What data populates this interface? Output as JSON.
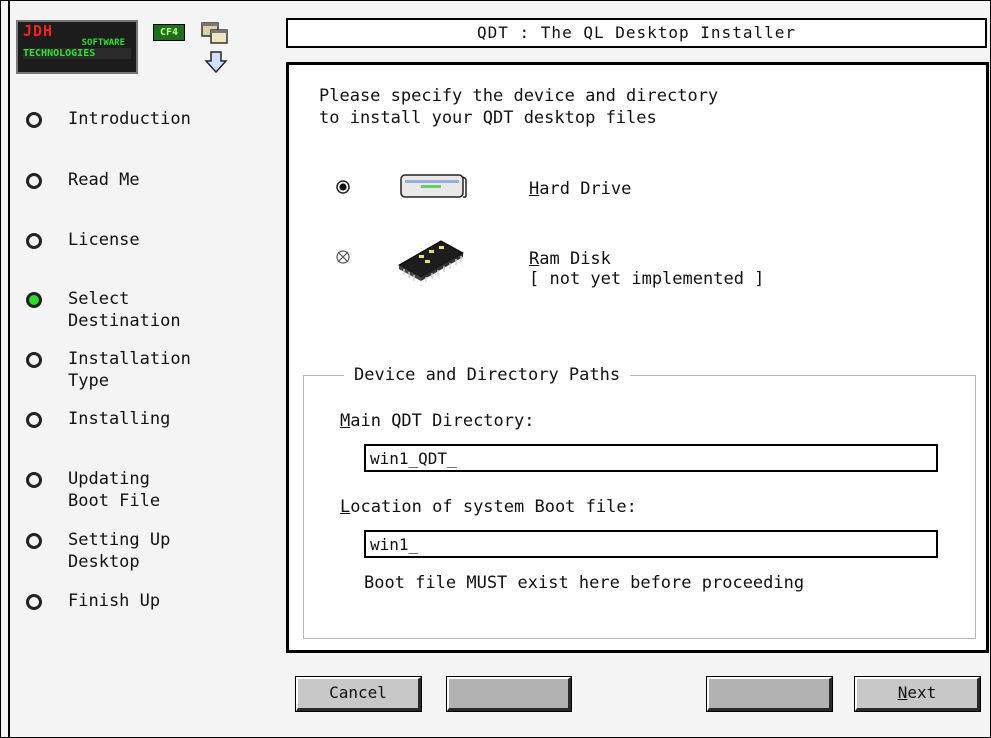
{
  "logo": {
    "line1": "JDH",
    "line2": "SOFTWARE",
    "line3": "TECHNOLOGIES",
    "badge": "CF4"
  },
  "icons": {
    "windows": "windows-icon",
    "down_arrow": "down-arrow-icon",
    "hard_drive": "hard-drive-icon",
    "ram_chip": "ram-chip-icon"
  },
  "sidebar": {
    "items": [
      {
        "label": "Introduction",
        "active": false
      },
      {
        "label": "Read Me",
        "active": false
      },
      {
        "label": "License",
        "active": false
      },
      {
        "label": "Select\nDestination",
        "active": true
      },
      {
        "label": "Installation\nType",
        "active": false
      },
      {
        "label": "Installing",
        "active": false
      },
      {
        "label": "Updating\nBoot File",
        "active": false
      },
      {
        "label": "Setting Up\nDesktop",
        "active": false
      },
      {
        "label": "Finish Up",
        "active": false
      }
    ]
  },
  "title": "QDT :  The QL Desktop Installer",
  "main": {
    "instructions": "Please specify the device and directory\nto install your QDT desktop files",
    "options": {
      "hard_drive": {
        "mnemonic": "H",
        "rest": "ard Drive",
        "selected": true
      },
      "ram_disk": {
        "mnemonic": "R",
        "rest": "am Disk",
        "note": "[ not yet implemented ]",
        "selected": false,
        "disabled": true
      }
    },
    "group": {
      "title": "Device and Directory Paths",
      "main_dir": {
        "mnemonic": "M",
        "rest": "ain QDT Directory:",
        "value": "win1_QDT_"
      },
      "boot_file": {
        "mnemonic": "L",
        "rest": "ocation of system Boot file:",
        "value": "win1_"
      },
      "warning": "Boot file MUST exist here before proceeding"
    }
  },
  "buttons": {
    "cancel": "Cancel",
    "blank1": "",
    "blank2": "",
    "next_mnemonic": "N",
    "next_rest": "ext"
  },
  "colors": {
    "active_step": "#2edb2e",
    "logo_red": "#ff2020",
    "logo_green": "#33e033"
  }
}
